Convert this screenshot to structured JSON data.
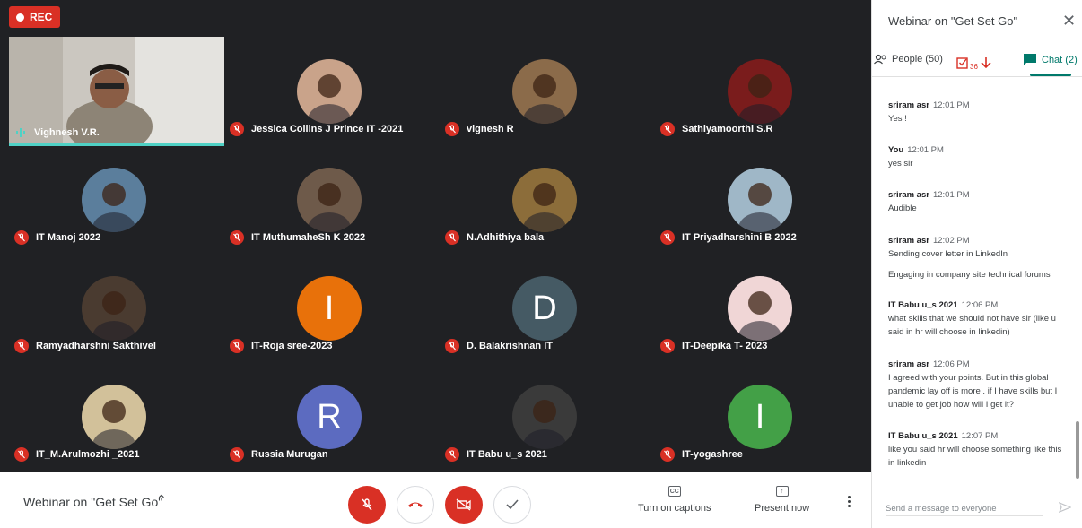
{
  "recording": {
    "label": "REC"
  },
  "meeting": {
    "title": "Webinar on \"Get Set Go\""
  },
  "video_participant": {
    "name": "Vighnesh V.R."
  },
  "participants": [
    {
      "name": "Jessica Collins J Prince IT -2021"
    },
    {
      "name": "vignesh R"
    },
    {
      "name": "Sathiyamoorthi S.R"
    },
    {
      "name": "IT Manoj 2022"
    },
    {
      "name": "IT MuthumaheSh K 2022"
    },
    {
      "name": "N.Adhithiya bala"
    },
    {
      "name": "IT Priyadharshini B 2022"
    },
    {
      "name": "Ramyadharshni Sakthivel"
    },
    {
      "name": "IT-Roja sree-2023",
      "letter": "I",
      "color": "#e8710a"
    },
    {
      "name": "D. Balakrishnan IT",
      "letter": "D",
      "color": "#455a64"
    },
    {
      "name": "IT-Deepika T- 2023"
    },
    {
      "name": "IT_M.Arulmozhi _2021"
    },
    {
      "name": "Russia Murugan",
      "letter": "R",
      "color": "#5c6bc0"
    },
    {
      "name": "IT Babu u_s 2021"
    },
    {
      "name": "IT-yogashree",
      "letter": "I",
      "color": "#43a047"
    }
  ],
  "controls": {
    "captions_label": "Turn on captions",
    "captions_icon": "CC",
    "present_label": "Present now"
  },
  "panel": {
    "title": "Webinar on \"Get Set Go\"",
    "people_tab": "People (50)",
    "attendance_count": "36",
    "chat_tab": "Chat (2)",
    "messages": [
      {
        "sender": "sriram asr",
        "time": "12:01 PM",
        "lines": [
          "Yes !"
        ]
      },
      {
        "sender": "You",
        "time": "12:01 PM",
        "lines": [
          "yes sir"
        ]
      },
      {
        "sender": "sriram asr",
        "time": "12:01 PM",
        "lines": [
          "Audible"
        ]
      },
      {
        "sender": "sriram asr",
        "time": "12:02 PM",
        "lines": [
          "Sending cover letter in LinkedIn",
          "Engaging in company site technical forums"
        ]
      },
      {
        "sender": "IT Babu u_s 2021",
        "time": "12:06 PM",
        "lines": [
          "what skills that we should not have sir (like u said in hr will choose in linkedin)"
        ]
      },
      {
        "sender": "sriram asr",
        "time": "12:06 PM",
        "lines": [
          "I agreed with your points. But in this global pandemic lay off is more . if I have skills but  I  unable to get job how will I get it?"
        ]
      },
      {
        "sender": "IT Babu u_s 2021",
        "time": "12:07 PM",
        "lines": [
          "like you said hr will choose something like this in linkedin"
        ]
      }
    ],
    "send_placeholder": "Send a message to everyone"
  }
}
